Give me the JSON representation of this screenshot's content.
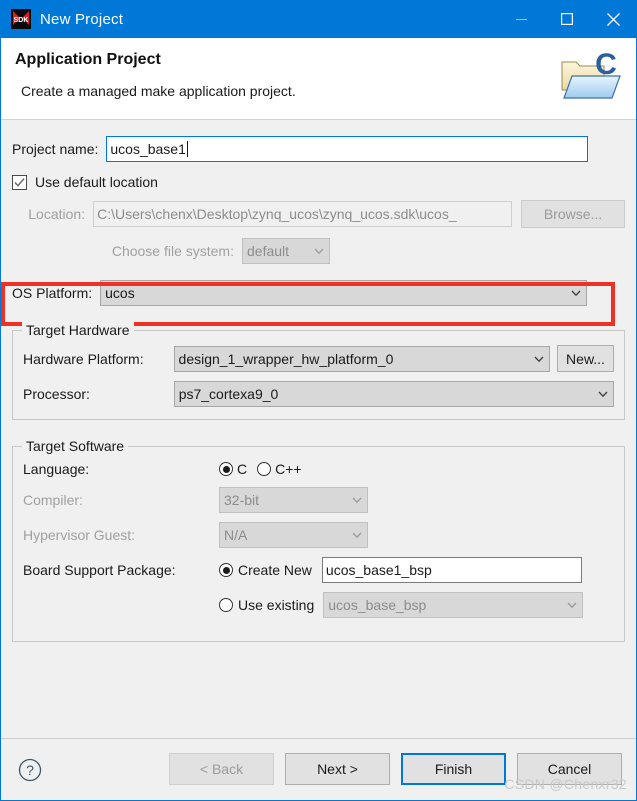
{
  "window": {
    "title": "New Project",
    "app_icon": "sdk-icon",
    "accent_color": "#0078d7",
    "controls": {
      "minimize": "minimize-icon",
      "maximize": "maximize-icon",
      "close": "close-icon"
    }
  },
  "header": {
    "title": "Application Project",
    "subtitle": "Create a managed make application project.",
    "banner_icon": "c-project-folder-icon"
  },
  "form": {
    "project_name": {
      "label": "Project name:",
      "value": "ucos_base1",
      "placeholder": ""
    },
    "use_default_location": {
      "label": "Use default location",
      "checked": true,
      "check_glyph": "check-icon"
    },
    "location": {
      "label": "Location:",
      "value": "C:\\Users\\chenx\\Desktop\\zynq_ucos\\zynq_ucos.sdk\\ucos_",
      "enabled": false,
      "browse_label": "Browse..."
    },
    "file_system": {
      "label": "Choose file system:",
      "value": "default",
      "enabled": false
    },
    "os_platform": {
      "label": "OS Platform:",
      "value": "ucos",
      "highlight_color": "#ee3124",
      "highlighted": true
    }
  },
  "target_hardware": {
    "title": "Target Hardware",
    "hardware_platform": {
      "label": "Hardware Platform:",
      "value": "design_1_wrapper_hw_platform_0"
    },
    "new_button": "New...",
    "processor": {
      "label": "Processor:",
      "value": "ps7_cortexa9_0"
    }
  },
  "target_software": {
    "title": "Target Software",
    "language": {
      "label": "Language:",
      "options": [
        {
          "label": "C",
          "selected": true
        },
        {
          "label": "C++",
          "selected": false
        }
      ]
    },
    "compiler": {
      "label": "Compiler:",
      "value": "32-bit",
      "enabled": false
    },
    "hypervisor_guest": {
      "label": "Hypervisor Guest:",
      "value": "N/A",
      "enabled": false
    },
    "board_support_package": {
      "label": "Board Support Package:",
      "create_new": {
        "label": "Create New",
        "selected": true,
        "value": "ucos_base1_bsp"
      },
      "use_existing": {
        "label": "Use existing",
        "selected": false,
        "value": "ucos_base_bsp",
        "enabled": false
      }
    }
  },
  "footer": {
    "help_icon": "help-icon",
    "buttons": [
      {
        "label": "< Back",
        "enabled": false,
        "default": false
      },
      {
        "label": "Next >",
        "enabled": true,
        "default": false
      },
      {
        "label": "Finish",
        "enabled": true,
        "default": true
      },
      {
        "label": "Cancel",
        "enabled": true,
        "default": false
      }
    ],
    "watermark": "CSDN @Chenxr32"
  }
}
